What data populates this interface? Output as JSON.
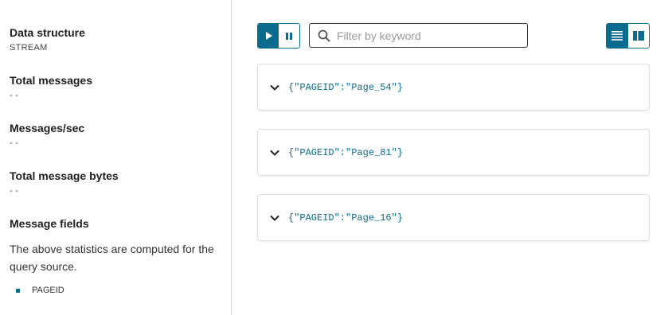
{
  "stats": [
    {
      "title": "Data structure",
      "value": "STREAM"
    },
    {
      "title": "Total messages",
      "value": "- -"
    },
    {
      "title": "Messages/sec",
      "value": "- -"
    },
    {
      "title": "Total message bytes",
      "value": "- -"
    },
    {
      "title": "Message fields",
      "value": ""
    }
  ],
  "note": "The above statistics are computed for the query source.",
  "fields": [
    "PAGEID"
  ],
  "toolbar": {
    "play_icon": "play-icon",
    "pause_icon": "pause-icon",
    "search_placeholder": "Filter by keyword",
    "search_value": "",
    "list_view_icon": "list-view-icon",
    "split_view_icon": "split-view-icon"
  },
  "messages": [
    {
      "text": "{\"PAGEID\":\"Page_54\"}"
    },
    {
      "text": "{\"PAGEID\":\"Page_81\"}"
    },
    {
      "text": "{\"PAGEID\":\"Page_16\"}"
    }
  ],
  "colors": {
    "accent": "#0a6b8f",
    "border": "#dedede"
  }
}
